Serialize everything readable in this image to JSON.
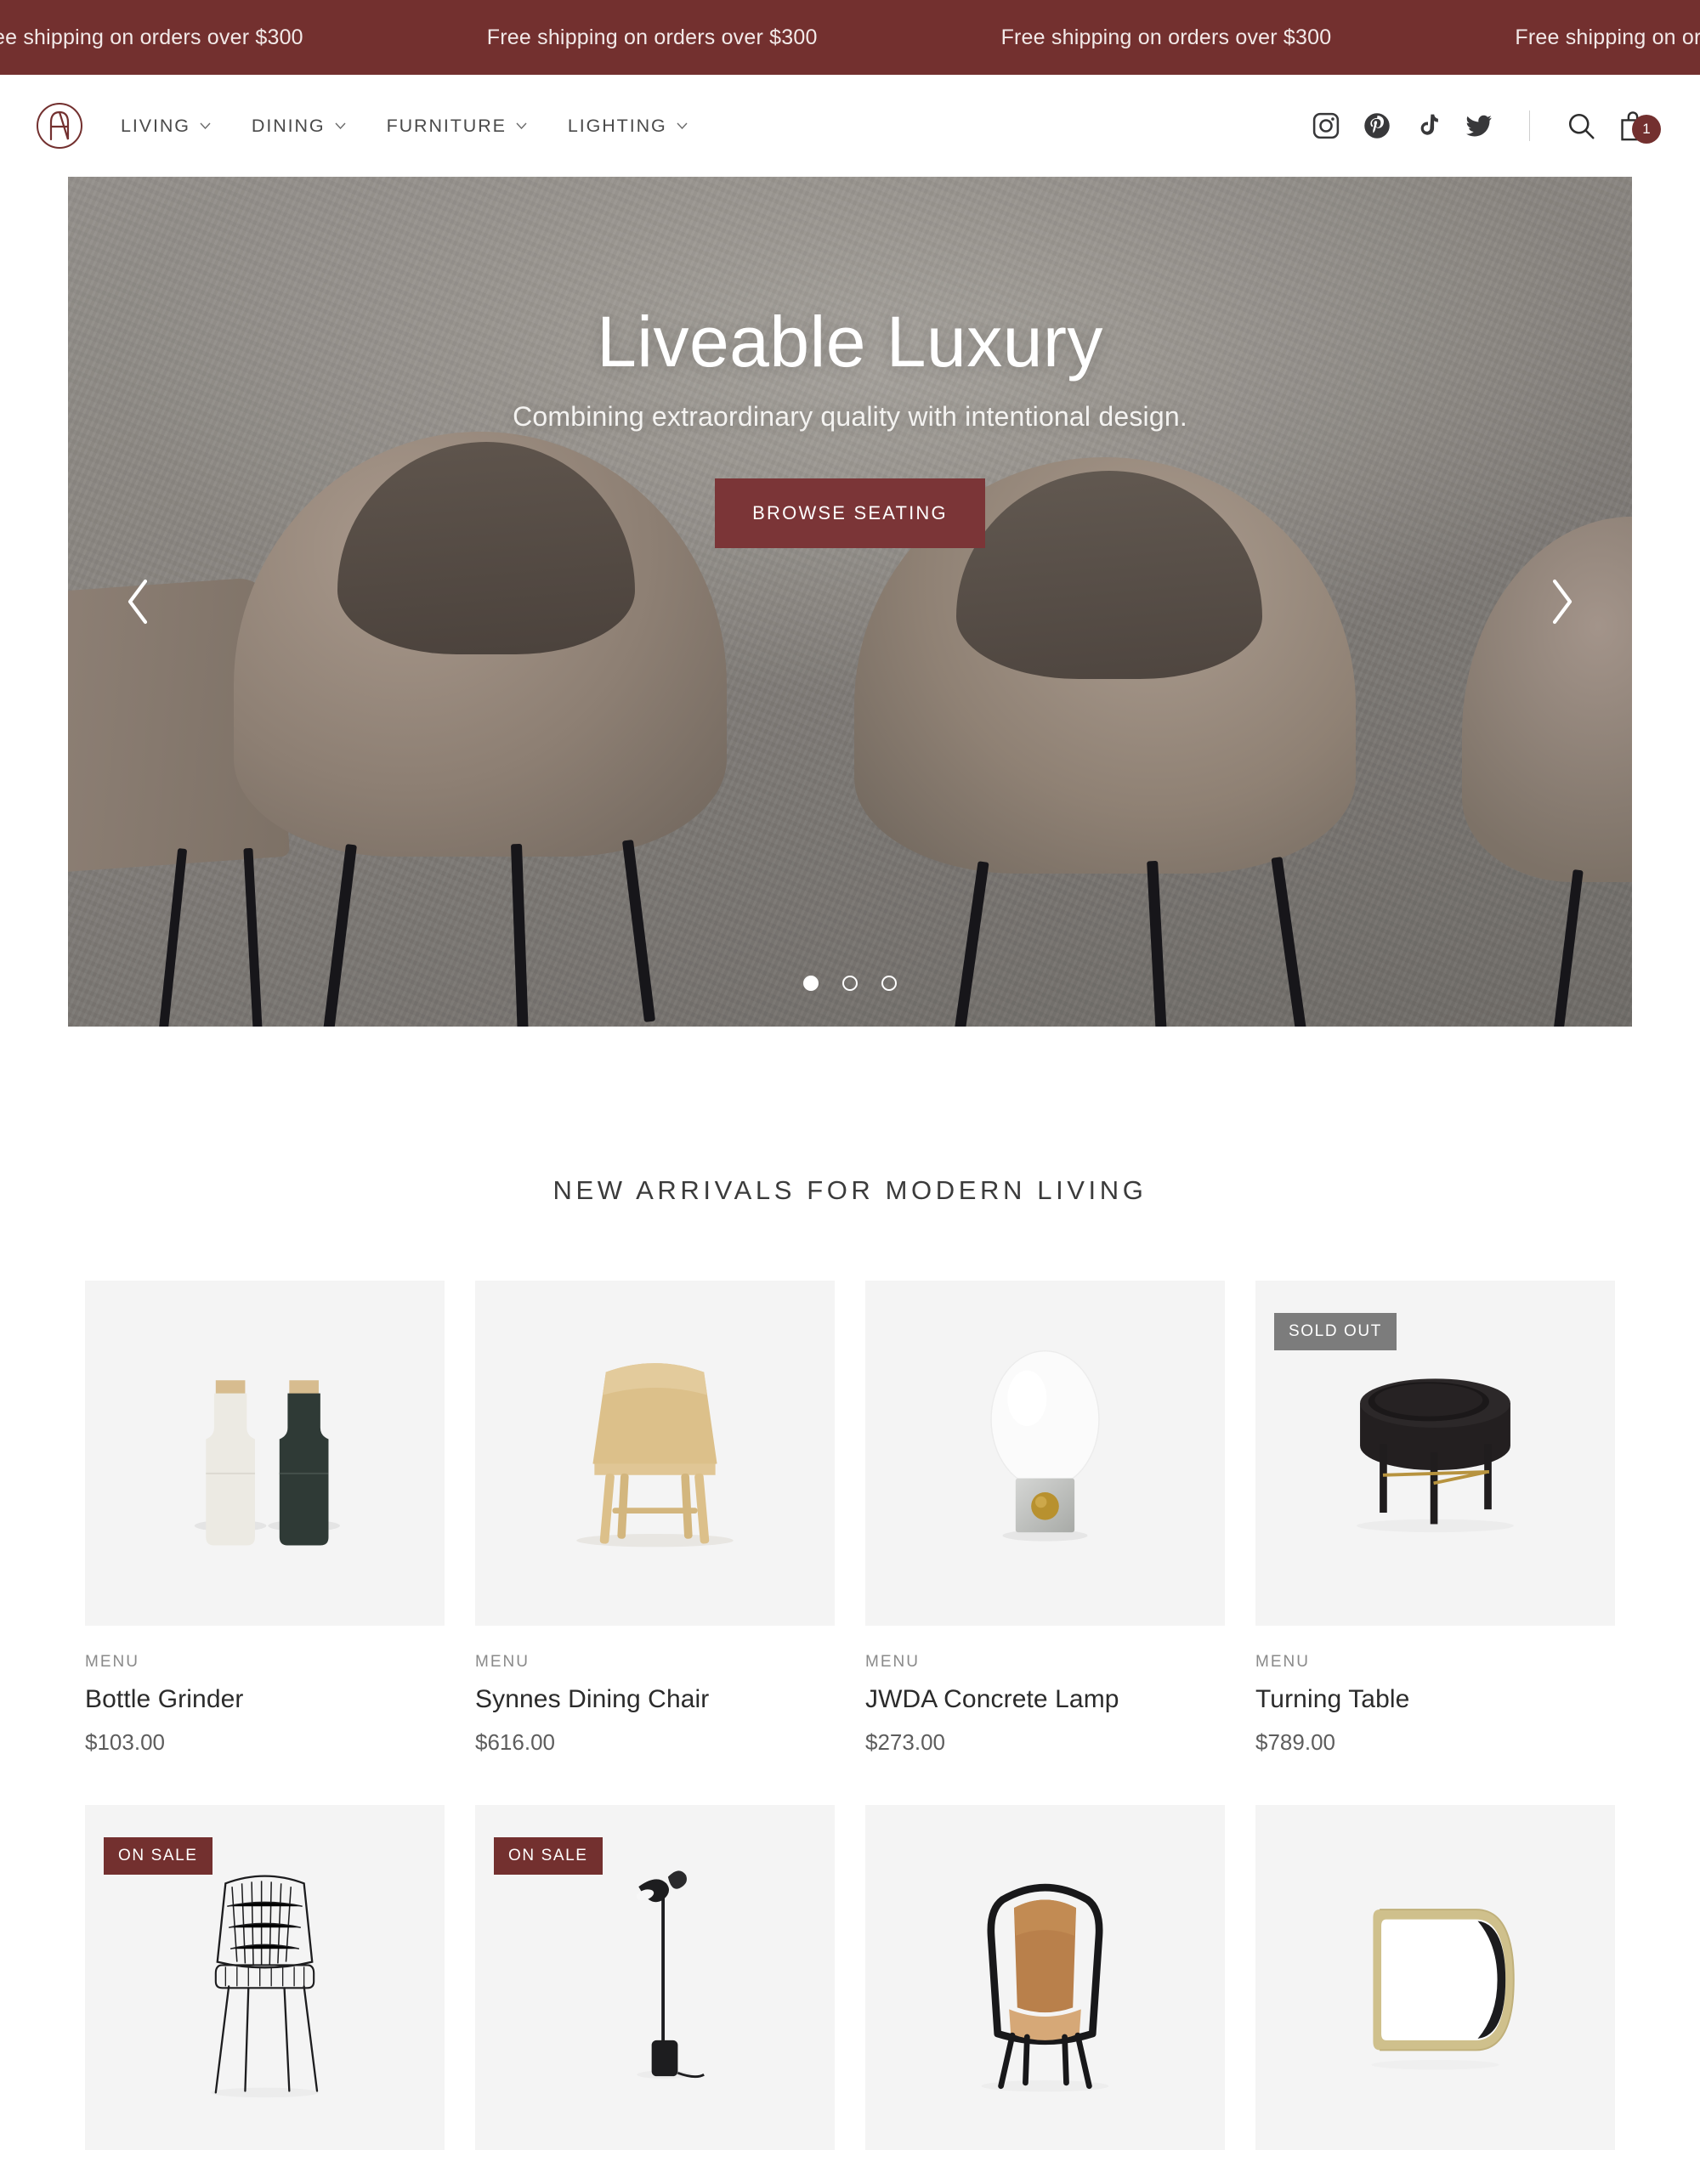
{
  "brand": {
    "accent": "#73302f",
    "accent_light": "#7b3537",
    "logo_letter": "A",
    "logo_name": "logo-circle-a"
  },
  "announcement": {
    "message": "Free shipping on orders over $300",
    "repeat": 6
  },
  "header": {
    "nav": [
      {
        "label": "LIVING",
        "has_dropdown": true
      },
      {
        "label": "DINING",
        "has_dropdown": true
      },
      {
        "label": "FURNITURE",
        "has_dropdown": true
      },
      {
        "label": "LIGHTING",
        "has_dropdown": true
      }
    ],
    "social": [
      {
        "name": "instagram-icon",
        "label": "Instagram"
      },
      {
        "name": "pinterest-icon",
        "label": "Pinterest"
      },
      {
        "name": "tiktok-icon",
        "label": "TikTok"
      },
      {
        "name": "twitter-icon",
        "label": "Twitter"
      }
    ],
    "search_label": "Search",
    "cart_label": "Cart",
    "cart_count": "1"
  },
  "hero": {
    "title": "Liveable Luxury",
    "subtitle": "Combining extraordinary quality with intentional design.",
    "cta": "BROWSE SEATING",
    "prev_label": "Previous slide",
    "next_label": "Next slide",
    "slide_count": 3,
    "active_slide": 1
  },
  "arrivals": {
    "title": "NEW ARRIVALS FOR MODERN LIVING",
    "products": [
      {
        "vendor": "MENU",
        "name": "Bottle Grinder",
        "price": "$103.00",
        "badge": null,
        "figure": "bottle-grinder"
      },
      {
        "vendor": "MENU",
        "name": "Synnes Dining Chair",
        "price": "$616.00",
        "badge": null,
        "figure": "oak-chair"
      },
      {
        "vendor": "MENU",
        "name": "JWDA Concrete Lamp",
        "price": "$273.00",
        "badge": null,
        "figure": "jwda-lamp"
      },
      {
        "vendor": "MENU",
        "name": "Turning Table",
        "price": "$789.00",
        "badge": "SOLD OUT",
        "badge_kind": "sold-out",
        "figure": "turning-table"
      },
      {
        "vendor": "",
        "name": "",
        "price": "",
        "badge": "ON SALE",
        "badge_kind": "on-sale",
        "figure": "wire-chair"
      },
      {
        "vendor": "",
        "name": "",
        "price": "",
        "badge": "ON SALE",
        "badge_kind": "on-sale",
        "figure": "floor-lamp"
      },
      {
        "vendor": "",
        "name": "",
        "price": "",
        "badge": null,
        "figure": "leather-chair"
      },
      {
        "vendor": "",
        "name": "",
        "price": "",
        "badge": null,
        "figure": "brass-mirror"
      }
    ]
  }
}
